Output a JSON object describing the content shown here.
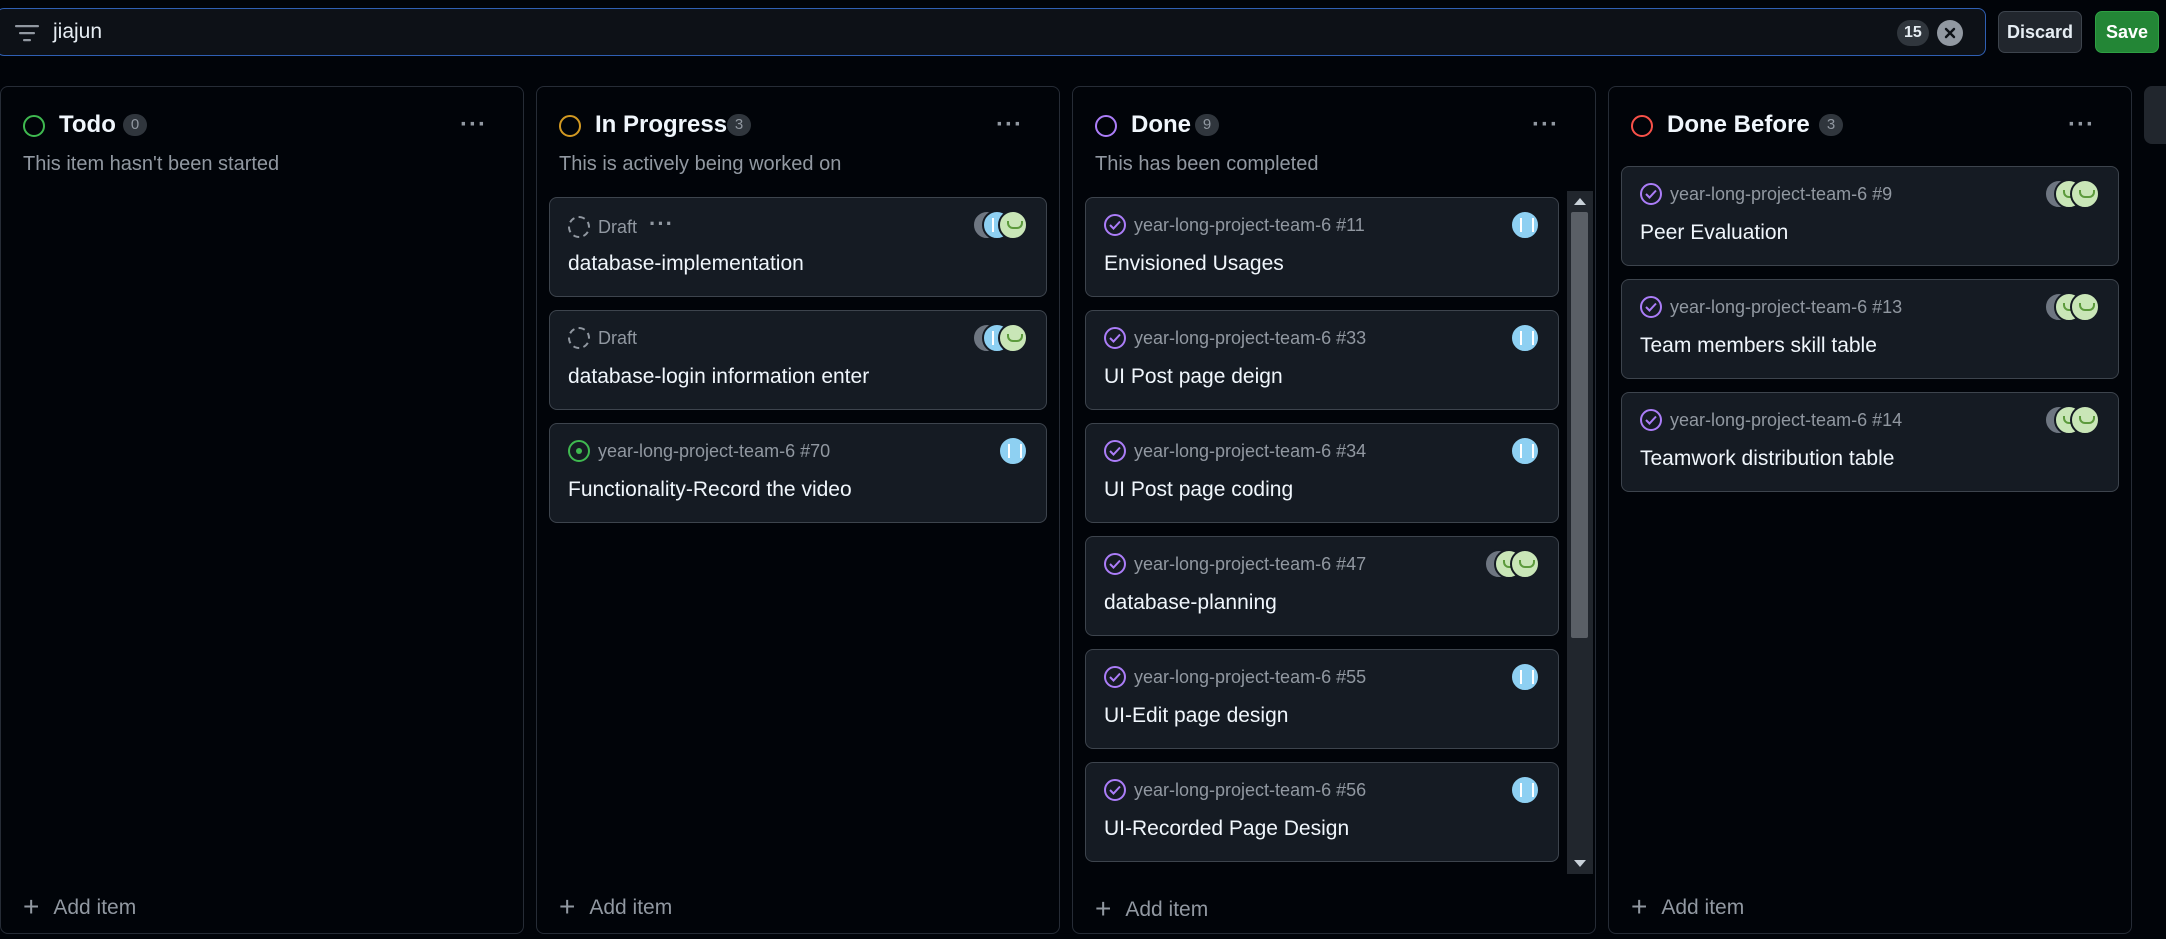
{
  "filter": {
    "query": "jiajun",
    "result_count": "15",
    "discard_label": "Discard",
    "save_label": "Save"
  },
  "columns": [
    {
      "title": "Todo",
      "count": "0",
      "description": "This item hasn't been started",
      "status_color": "#3fb950",
      "add_label": "Add item",
      "cards": []
    },
    {
      "title": "In Progress",
      "count": "3",
      "description": "This is actively being worked on",
      "status_color": "#d29922",
      "add_label": "Add item",
      "cards": [
        {
          "meta": "Draft",
          "title": "database-implementation",
          "icon": "draft-icon"
        },
        {
          "meta": "Draft",
          "title": "database-login information enter",
          "icon": "draft-icon"
        },
        {
          "meta": "year-long-project-team-6 #70",
          "title": "Functionality-Record the video",
          "icon": "open-issue-icon"
        }
      ]
    },
    {
      "title": "Done",
      "count": "9",
      "description": "This has been completed",
      "status_color": "#ab7df8",
      "add_label": "Add item",
      "cards": [
        {
          "meta": "year-long-project-team-6 #11",
          "title": "Envisioned Usages",
          "icon": "closed-issue-icon"
        },
        {
          "meta": "year-long-project-team-6 #33",
          "title": "UI Post page deign",
          "icon": "closed-issue-icon"
        },
        {
          "meta": "year-long-project-team-6 #34",
          "title": "UI Post page coding",
          "icon": "closed-issue-icon"
        },
        {
          "meta": "year-long-project-team-6 #47",
          "title": "database-planning",
          "icon": "closed-issue-icon"
        },
        {
          "meta": "year-long-project-team-6 #55",
          "title": "UI-Edit page design",
          "icon": "closed-issue-icon"
        },
        {
          "meta": "year-long-project-team-6 #56",
          "title": "UI-Recorded Page Design",
          "icon": "closed-issue-icon"
        }
      ]
    },
    {
      "title": "Done Before",
      "count": "3",
      "description": "",
      "status_color": "#f85149",
      "add_label": "Add item",
      "cards": [
        {
          "meta": "year-long-project-team-6 #9",
          "title": "Peer Evaluation",
          "icon": "closed-issue-icon"
        },
        {
          "meta": "year-long-project-team-6 #13",
          "title": "Team members skill table",
          "icon": "closed-issue-icon"
        },
        {
          "meta": "year-long-project-team-6 #14",
          "title": "Teamwork distribution table",
          "icon": "closed-issue-icon"
        }
      ]
    }
  ]
}
